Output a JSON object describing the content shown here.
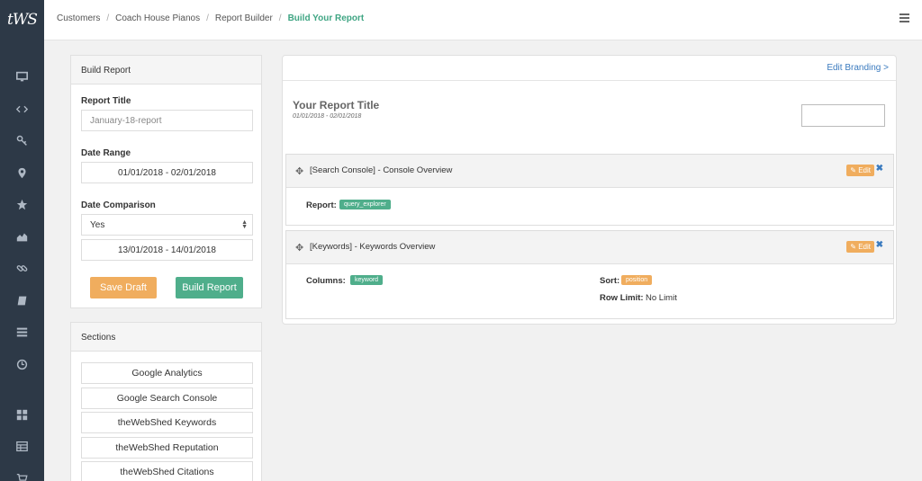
{
  "app": {
    "logo": "tWS"
  },
  "rail": {
    "icons": [
      "monitor-icon",
      "code-icon",
      "key-icon",
      "map-pin-icon",
      "star-icon",
      "area-chart-icon",
      "link-icon",
      "book-icon",
      "list-icon",
      "clock-icon",
      "grid-icon",
      "table-icon",
      "cart-icon"
    ]
  },
  "breadcrumb": {
    "items": [
      "Customers",
      "Coach House Pianos",
      "Report Builder"
    ],
    "active": "Build Your Report"
  },
  "build_report": {
    "header": "Build Report",
    "report_title_label": "Report Title",
    "report_title_placeholder": "January-18-report",
    "date_range_label": "Date Range",
    "date_range_value": "01/01/2018 - 02/01/2018",
    "date_comparison_label": "Date Comparison",
    "date_comparison_selected": "Yes",
    "comparison_range_value": "13/01/2018 - 14/01/2018",
    "save_draft_label": "Save Draft",
    "build_report_label": "Build Report"
  },
  "sections": {
    "header": "Sections",
    "items": [
      "Google Analytics",
      "Google Search Console",
      "theWebShed Keywords",
      "theWebShed Reputation",
      "theWebShed Citations"
    ]
  },
  "report": {
    "edit_branding_label": "Edit Branding >",
    "title": "Your Report Title",
    "dates": "01/01/2018 - 02/01/2018",
    "blocks": [
      {
        "title": "[Search Console] - Console Overview",
        "edit_label": "Edit",
        "report_label": "Report:",
        "report_tag": "query_explorer"
      },
      {
        "title": "[Keywords] - Keywords Overview",
        "edit_label": "Edit",
        "columns_label": "Columns:",
        "columns_tag": "keyword",
        "sort_label": "Sort:",
        "sort_tag": "position",
        "row_limit_label": "Row Limit:",
        "row_limit_value": "No Limit"
      }
    ]
  },
  "colors": {
    "accent_green": "#4fae8b",
    "accent_orange": "#f0ad5e",
    "link_blue": "#3b7bbf",
    "rail_bg": "#2d3947"
  }
}
